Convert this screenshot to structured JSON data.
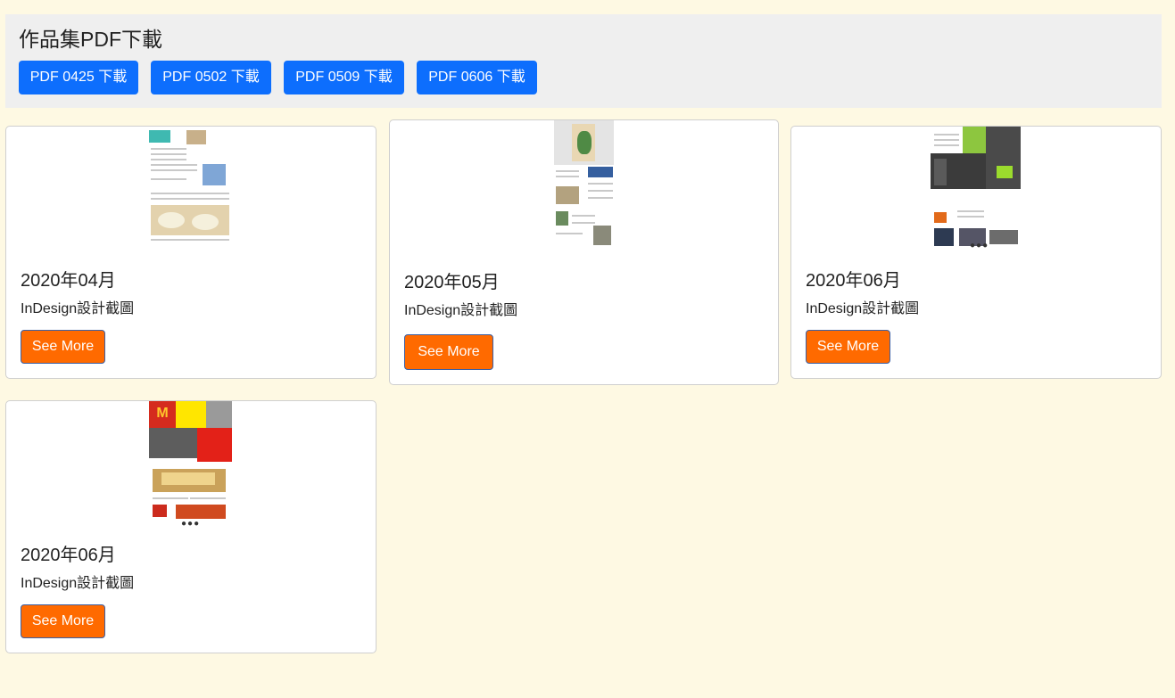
{
  "header": {
    "title": "作品集PDF下載",
    "buttons": [
      "PDF 0425 下載",
      "PDF 0502 下載",
      "PDF 0509 下載",
      "PDF 0606 下載"
    ]
  },
  "cards": [
    {
      "title": "2020年04月",
      "subtitle": "InDesign設計截圖",
      "button": "See More"
    },
    {
      "title": "2020年05月",
      "subtitle": "InDesign設計截圖",
      "button": "See More"
    },
    {
      "title": "2020年06月",
      "subtitle": "InDesign設計截圖",
      "button": "See More"
    },
    {
      "title": "2020年06月",
      "subtitle": "InDesign設計截圖",
      "button": "See More"
    }
  ],
  "colors": {
    "background": "#fef9e3",
    "header_bg": "#efefef",
    "primary_button": "#0d6efd",
    "accent_button": "#ff6a00"
  }
}
